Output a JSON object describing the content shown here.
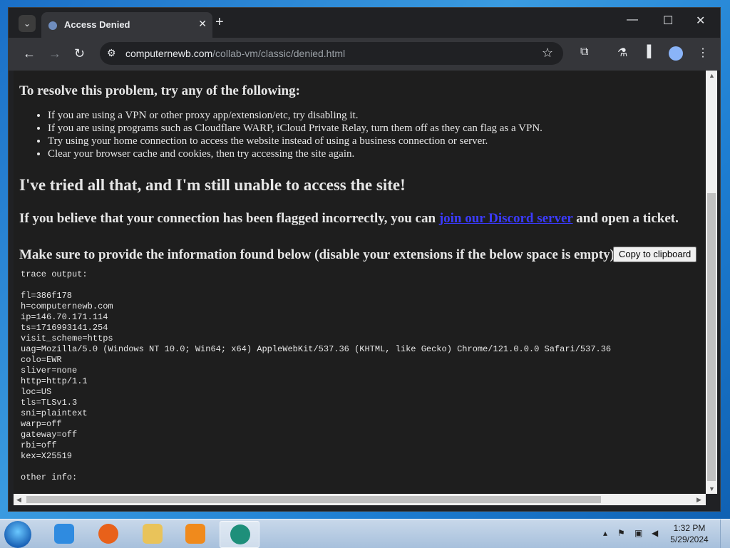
{
  "browser": {
    "tab_title": "Access Denied",
    "url_domain": "computernewb.com",
    "url_path": "/collab-vm/classic/denied.html"
  },
  "page": {
    "resolve_heading": "To resolve this problem, try any of the following:",
    "resolve_items": [
      "If you are using a VPN or other proxy app/extension/etc, try disabling it.",
      "If you are using programs such as Cloudflare WARP, iCloud Private Relay, turn them off as they can flag as a VPN.",
      "Try using your home connection to access the website instead of using a business connection or server.",
      "Clear your browser cache and cookies, then try accessing the site again."
    ],
    "still_heading": "I've tried all that, and I'm still unable to access the site!",
    "flagged_prefix": "If you believe that your connection has been flagged incorrectly, you can ",
    "flagged_link": "join our Discord server",
    "flagged_suffix": " and open a ticket.",
    "provide_text": "Make sure to provide the information found below (disable your extensions if the below space is empty):",
    "copy_button": "Copy to clipboard",
    "trace": "trace output:\n\nfl=386f178\nh=computernewb.com\nip=146.70.171.114\nts=1716993141.254\nvisit_scheme=https\nuag=Mozilla/5.0 (Windows NT 10.0; Win64; x64) AppleWebKit/537.36 (KHTML, like Gecko) Chrome/121.0.0.0 Safari/537.36\ncolo=EWR\nsliver=none\nhttp=http/1.1\nloc=US\ntls=TLSv1.3\nsni=plaintext\nwarp=off\ngateway=off\nrbi=off\nkex=X25519\n\nother info:"
  },
  "taskbar": {
    "time": "1:32 PM",
    "date": "5/29/2024"
  },
  "icons": {
    "minimize": "—",
    "maximize": "☐",
    "close": "✕"
  },
  "colors": {
    "page_bg": "#1e1e1e",
    "link": "#3b3bff"
  }
}
